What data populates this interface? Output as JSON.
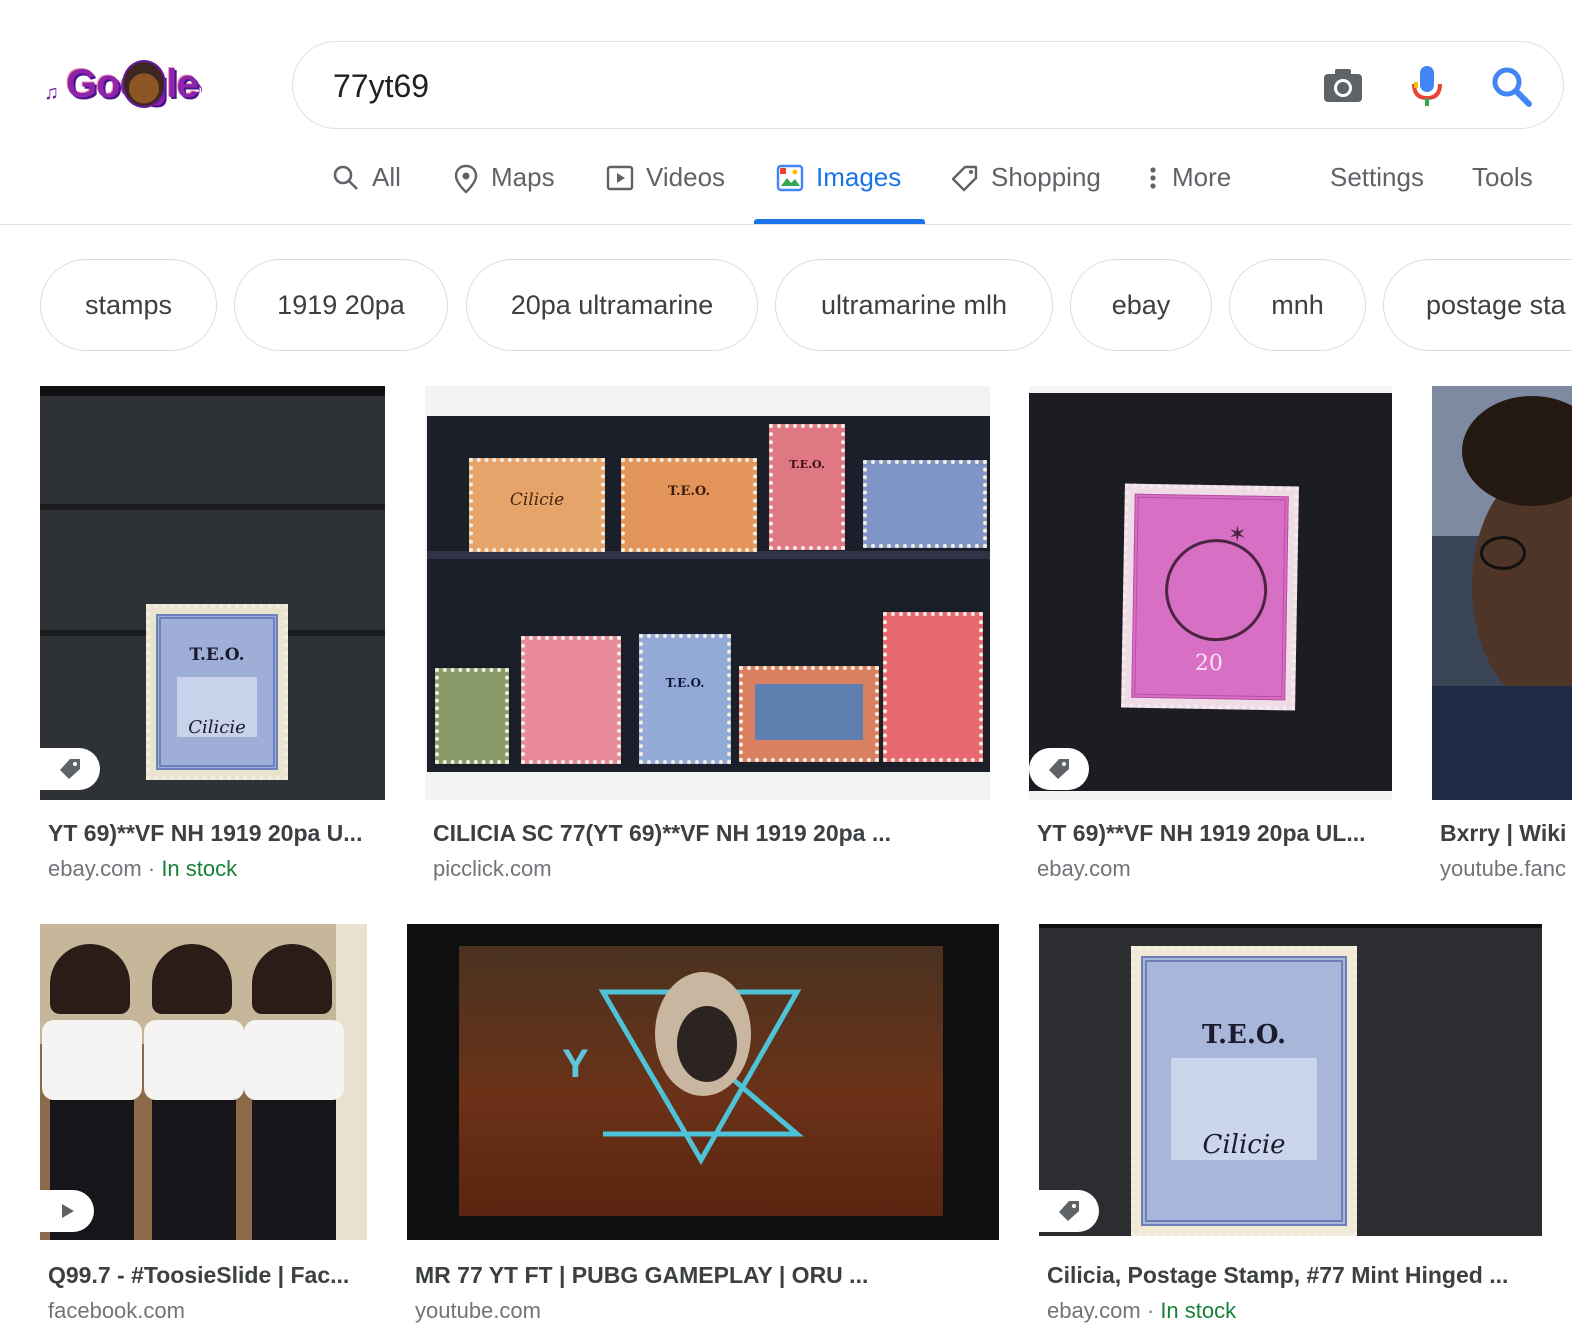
{
  "search": {
    "query": "77yt69",
    "logo_text": "Google"
  },
  "colors": {
    "accent": "#1a73e8",
    "in_stock": "#188038"
  },
  "tabs": [
    {
      "label": "All",
      "icon": "search-icon"
    },
    {
      "label": "Maps",
      "icon": "map-pin-icon"
    },
    {
      "label": "Videos",
      "icon": "play-icon"
    },
    {
      "label": "Images",
      "icon": "image-icon",
      "active": true
    },
    {
      "label": "Shopping",
      "icon": "tag-icon"
    },
    {
      "label": "More",
      "icon": "more-vert-icon"
    }
  ],
  "tools": {
    "settings": "Settings",
    "tools": "Tools"
  },
  "chips": [
    "stamps",
    "1919 20pa",
    "20pa ultramarine",
    "ultramarine mlh",
    "ebay",
    "mnh",
    "postage sta"
  ],
  "results": [
    {
      "title": "YT 69)**VF NH 1919 20pa U...",
      "source": "ebay.com",
      "stock": "In stock",
      "badge": "tag-icon"
    },
    {
      "title": "CILICIA SC 77(YT 69)**VF NH 1919 20pa ...",
      "source": "picclick.com"
    },
    {
      "title": "YT 69)**VF NH 1919 20pa UL...",
      "source": "ebay.com",
      "badge": "tag-icon"
    },
    {
      "title": "Bxrry | Wiki",
      "source": "youtube.fanc"
    },
    {
      "title": "Q99.7 - #ToosieSlide | Fac...",
      "source": "facebook.com",
      "badge": "play-icon"
    },
    {
      "title": "MR 77 YT FT | PUBG GAMEPLAY | ORU ...",
      "source": "youtube.com"
    },
    {
      "title": "Cilicia, Postage Stamp, #77 Mint Hinged ...",
      "source": "ebay.com",
      "stock": "In stock",
      "badge": "tag-icon"
    }
  ],
  "stamp_text": {
    "overprint": "T.E.O.",
    "cilicie": "Cilicie",
    "twenty": "20",
    "y": "Y"
  }
}
